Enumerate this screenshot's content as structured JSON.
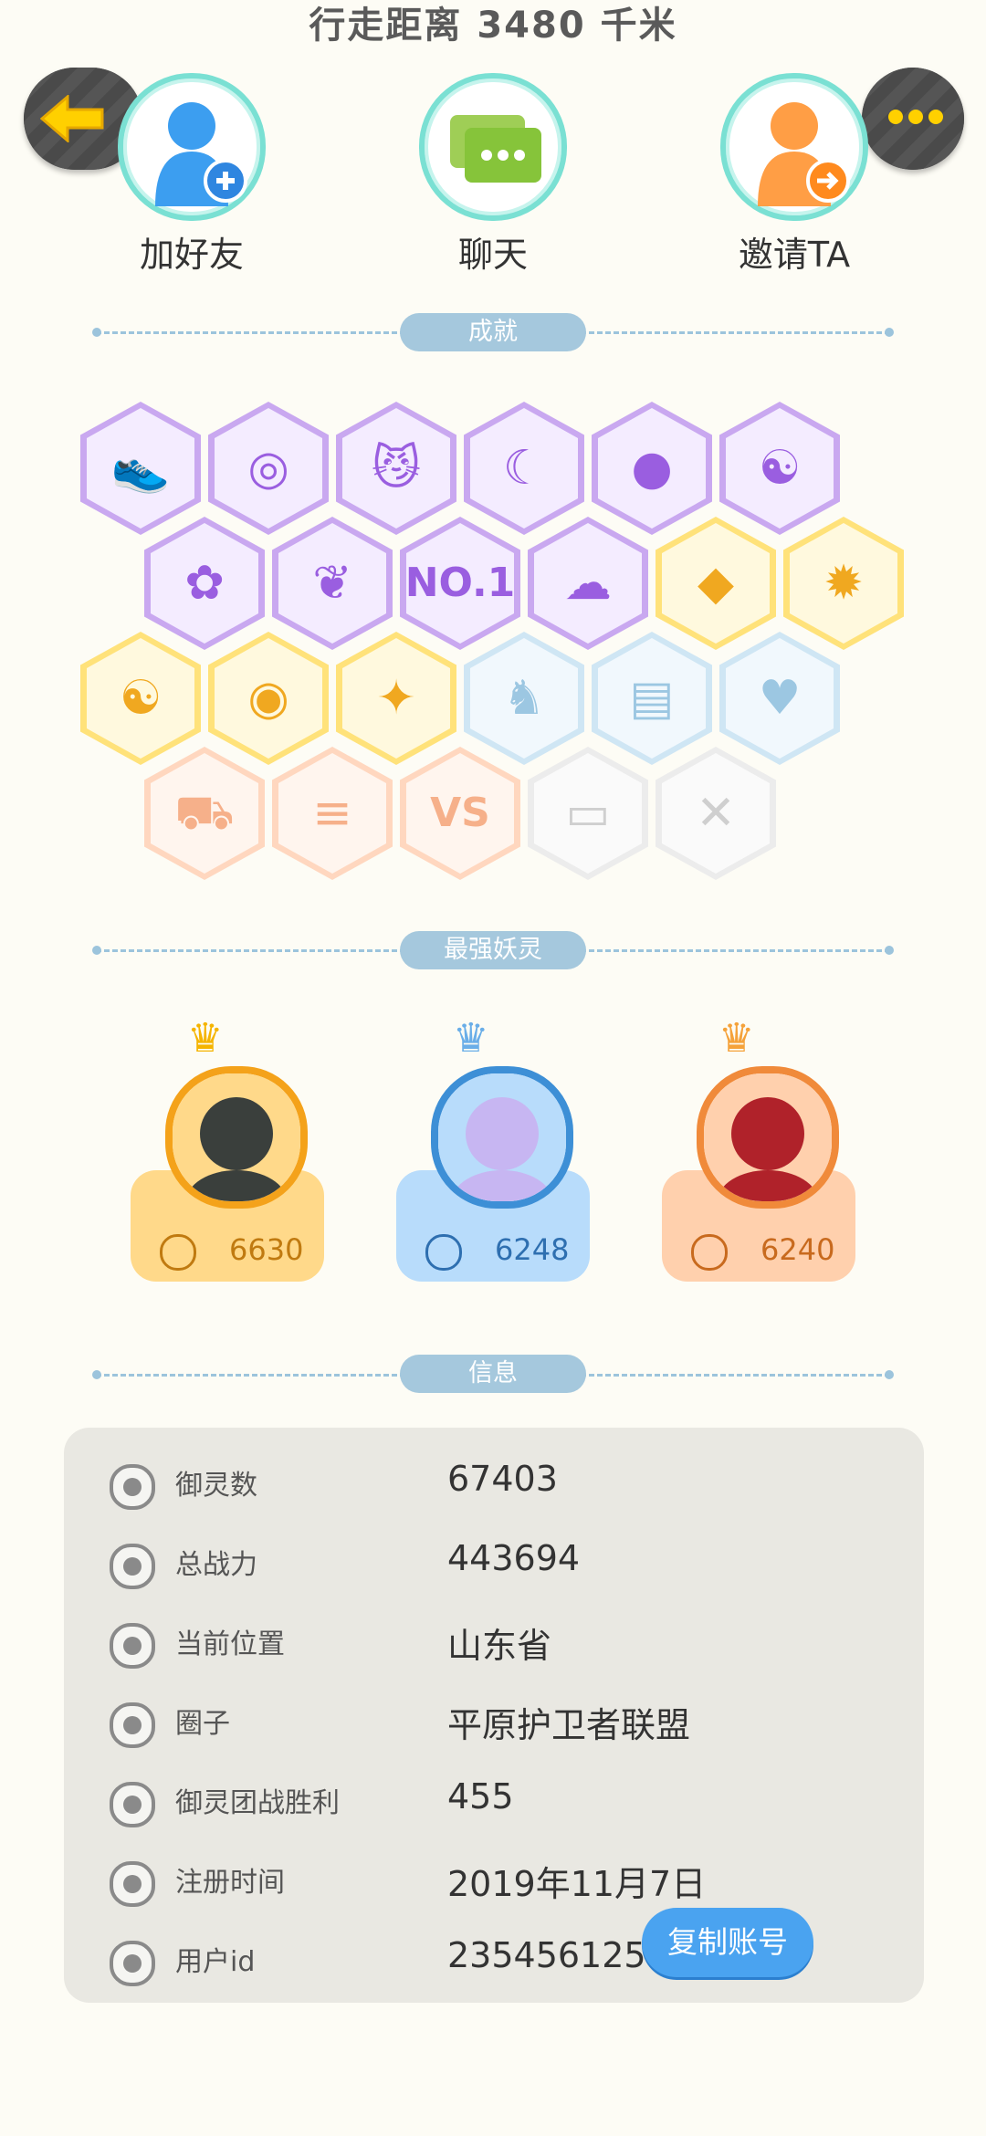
{
  "header": {
    "title": "行走距离 3480 千米"
  },
  "actions": {
    "add_friend": "加好友",
    "chat": "聊天",
    "invite": "邀请TA"
  },
  "sections": {
    "achievements": "成就",
    "top_spirits": "最强妖灵",
    "info": "信息"
  },
  "achievements": [
    {
      "icon": "sneaker-icon",
      "color": "purple"
    },
    {
      "icon": "target-icon",
      "color": "purple"
    },
    {
      "icon": "cat-face-icon",
      "color": "purple"
    },
    {
      "icon": "moon-icon",
      "color": "purple"
    },
    {
      "icon": "orb-icon",
      "color": "purple"
    },
    {
      "icon": "yin-yang-icon",
      "color": "purple"
    },
    {
      "icon": "fox-spirit-icon",
      "color": "purple"
    },
    {
      "icon": "fish-spirit-icon",
      "color": "purple"
    },
    {
      "icon": "no1-icon",
      "color": "purple",
      "text": "NO.1"
    },
    {
      "icon": "sad-spirit-icon",
      "color": "purple"
    },
    {
      "icon": "gem-icon",
      "color": "gold"
    },
    {
      "icon": "flame-spirit-icon",
      "color": "gold"
    },
    {
      "icon": "taiji-book-icon",
      "color": "gold"
    },
    {
      "icon": "scroll-icon",
      "color": "gold"
    },
    {
      "icon": "beast-icon",
      "color": "gold"
    },
    {
      "icon": "demon-icon",
      "color": "blue"
    },
    {
      "icon": "open-book-icon",
      "color": "blue"
    },
    {
      "icon": "love-cats-icon",
      "color": "blue"
    },
    {
      "icon": "cart-cat-icon",
      "color": "orange"
    },
    {
      "icon": "dog-list-icon",
      "color": "orange"
    },
    {
      "icon": "vs-icon",
      "color": "orange",
      "text": "VS"
    },
    {
      "icon": "belt-icon",
      "color": "grey"
    },
    {
      "icon": "crossed-swords-icon",
      "color": "grey"
    }
  ],
  "top_spirits": [
    {
      "score": "6630",
      "theme": "gold"
    },
    {
      "score": "6248",
      "theme": "blue"
    },
    {
      "score": "6240",
      "theme": "orange"
    }
  ],
  "info": {
    "rows": [
      {
        "label": "御灵数",
        "value": "67403",
        "icon": "spirit-count-icon"
      },
      {
        "label": "总战力",
        "value": "443694",
        "icon": "power-icon"
      },
      {
        "label": "当前位置",
        "value": "山东省",
        "icon": "location-icon"
      },
      {
        "label": "圈子",
        "value": "平原护卫者联盟",
        "icon": "circle-icon"
      },
      {
        "label": "御灵团战胜利",
        "value": "455",
        "icon": "team-win-icon"
      },
      {
        "label": "注册时间",
        "value": "2019年11月7日",
        "icon": "clock-icon"
      },
      {
        "label": "用户id",
        "value": "23545612578",
        "icon": "id-icon"
      }
    ],
    "copy_button": "复制账号"
  },
  "colors": {
    "accent_blue": "#4aa3f0",
    "teal_ring": "#7ae0d3",
    "gold_card": "#ffd98a",
    "blue_card": "#b8dcfb",
    "orange_card": "#ffd0ad"
  }
}
